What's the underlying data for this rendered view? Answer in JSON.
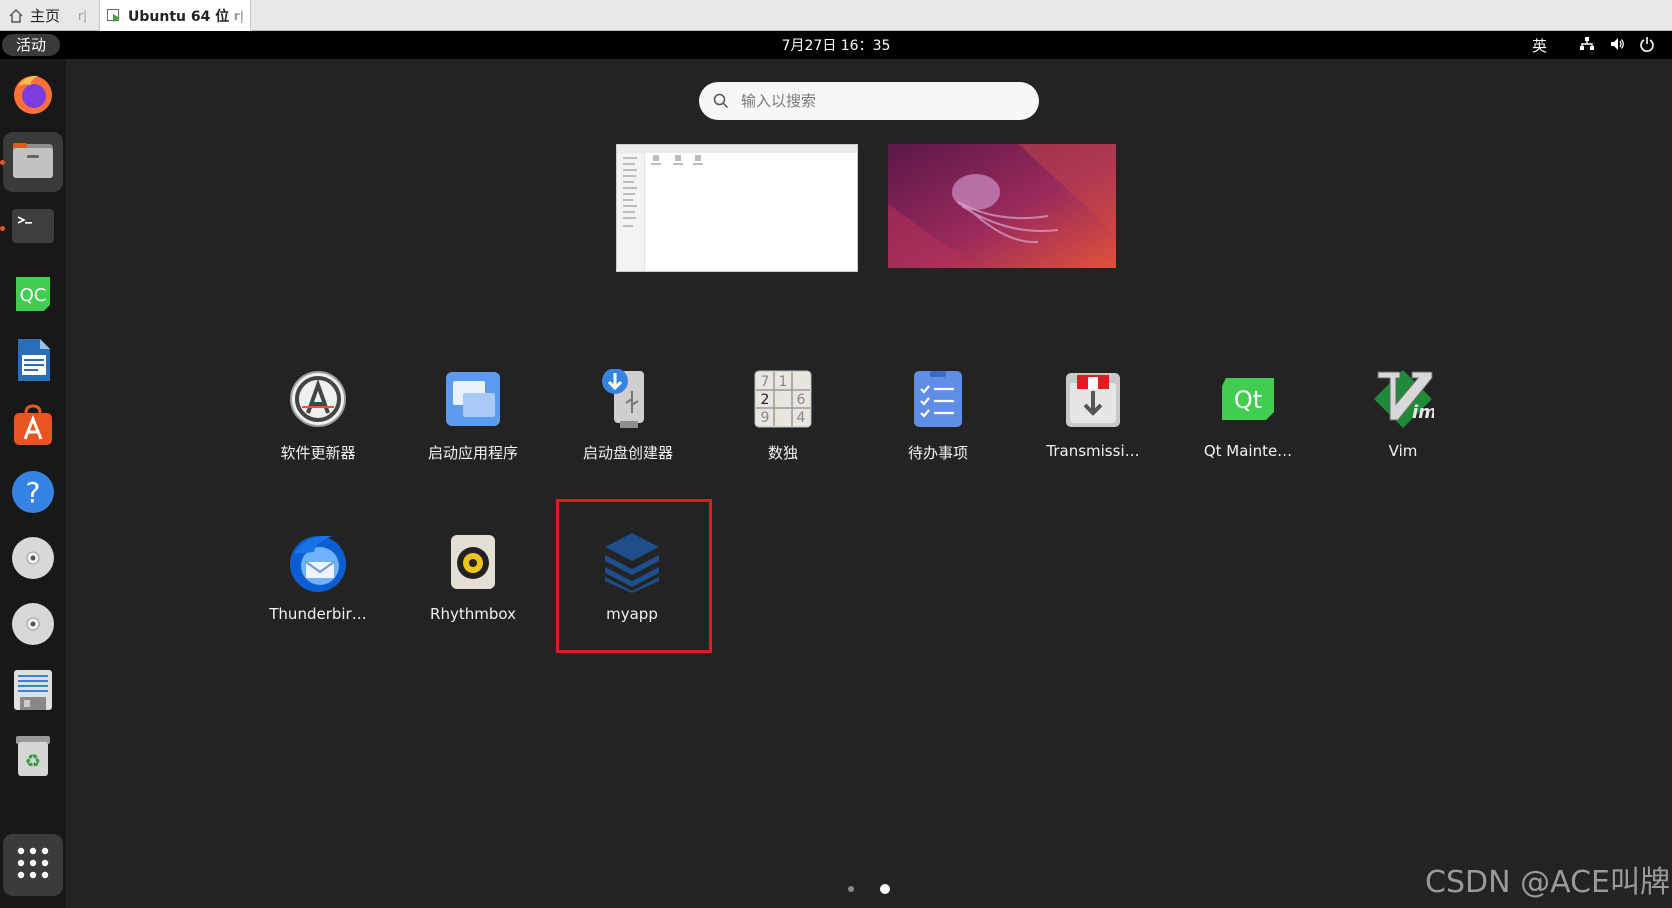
{
  "vm_tabs": {
    "home": {
      "label": "主页",
      "icon": "home-icon"
    },
    "active": {
      "label": "Ubuntu 64 位",
      "icon": "vm-play-icon"
    }
  },
  "topbar": {
    "activities": "活动",
    "clock": "7月27日 16：35",
    "input_method": "英",
    "tray_icons": [
      "network-icon",
      "volume-icon",
      "power-icon"
    ]
  },
  "dock": {
    "items": [
      {
        "name": "firefox",
        "icon": "firefox-icon",
        "running": false
      },
      {
        "name": "files",
        "icon": "folder-icon",
        "running": true
      },
      {
        "name": "terminal",
        "icon": "terminal-icon",
        "running": true
      },
      {
        "name": "qt-creator",
        "icon": "qt-creator-icon",
        "running": false
      },
      {
        "name": "libreoffice-writer",
        "icon": "writer-icon",
        "running": false
      },
      {
        "name": "ubuntu-software",
        "icon": "software-store-icon",
        "running": false
      },
      {
        "name": "help",
        "icon": "help-icon",
        "running": false
      },
      {
        "name": "disc-1",
        "icon": "cdrom-icon",
        "running": false
      },
      {
        "name": "disc-2",
        "icon": "cdrom-icon",
        "running": false
      },
      {
        "name": "text-editor",
        "icon": "text-editor-icon",
        "running": false
      },
      {
        "name": "trash",
        "icon": "trash-icon",
        "running": false
      }
    ],
    "show_apps_icon": "app-grid-icon"
  },
  "search": {
    "placeholder": "输入以搜索",
    "value": ""
  },
  "apps": [
    {
      "label": "软件更新器",
      "icon": "software-updater-icon"
    },
    {
      "label": "启动应用程序",
      "icon": "startup-apps-icon"
    },
    {
      "label": "启动盘创建器",
      "icon": "usb-creator-icon"
    },
    {
      "label": "数独",
      "icon": "sudoku-icon"
    },
    {
      "label": "待办事项",
      "icon": "todo-icon"
    },
    {
      "label": "Transmissi…",
      "icon": "transmission-icon"
    },
    {
      "label": "Qt Mainte…",
      "icon": "qt-maintenance-icon"
    },
    {
      "label": "Vim",
      "icon": "vim-icon"
    },
    {
      "label": "Thunderbir…",
      "icon": "thunderbird-icon"
    },
    {
      "label": "Rhythmbox",
      "icon": "rhythmbox-icon"
    },
    {
      "label": "myapp",
      "icon": "myapp-stack-icon"
    }
  ],
  "sudoku_digits": [
    "7",
    "1",
    "2",
    "6",
    "9",
    "4"
  ],
  "qt_text": "Qt",
  "qc_text": "QC",
  "page_indicator": {
    "pages": 2,
    "current": 2
  },
  "watermark": "CSDN @ACE叫牌",
  "colors": {
    "highlight": "#e01b24",
    "ubuntu_orange": "#e95420",
    "dock_bg": "#181818"
  }
}
